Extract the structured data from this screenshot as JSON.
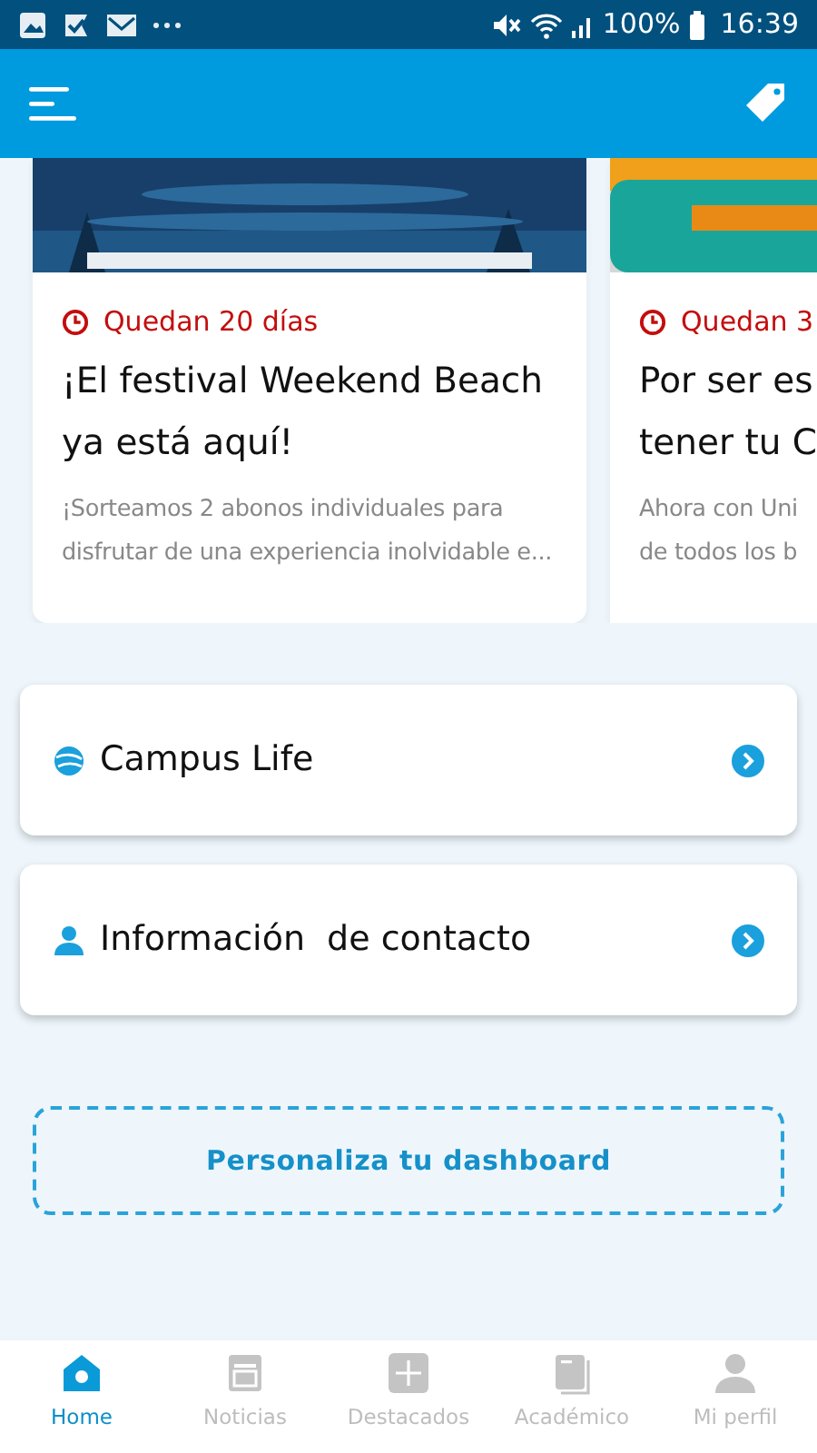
{
  "status_bar": {
    "battery": "100%",
    "time": "16:39"
  },
  "news_cards": [
    {
      "countdown": "Quedan 20 días",
      "title": "¡El festival Weekend Beach ya está aquí!",
      "excerpt": "¡Sorteamos 2 abonos individuales para disfrutar de una experiencia inolvidable e..."
    },
    {
      "countdown": "Quedan 3",
      "title_lines": [
        "Por ser es",
        "tener tu C"
      ],
      "excerpt_lines": [
        "Ahora con Uni",
        "de todos los b"
      ]
    }
  ],
  "links": [
    {
      "label": "Campus Life",
      "kind": "globe"
    },
    {
      "label": "Información  de contacto",
      "kind": "person"
    }
  ],
  "customize_button": "Personaliza tu dashboard",
  "bottom_nav": [
    {
      "label": "Home",
      "kind": "home",
      "selected": true
    },
    {
      "label": "Noticias",
      "kind": "news",
      "selected": false
    },
    {
      "label": "Destacados",
      "kind": "plus",
      "selected": false
    },
    {
      "label": "Académico",
      "kind": "book",
      "selected": false
    },
    {
      "label": "Mi perfil",
      "kind": "person",
      "selected": false
    }
  ]
}
